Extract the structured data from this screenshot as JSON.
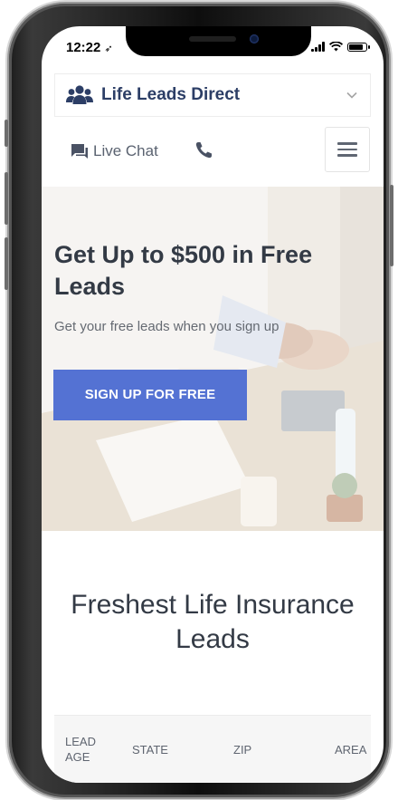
{
  "status_bar": {
    "time": "12:22"
  },
  "brand": {
    "name": "Life Leads Direct",
    "color": "#2c3e66"
  },
  "nav": {
    "live_chat_label": "Live Chat"
  },
  "hero": {
    "title": "Get Up to $500 in Free Leads",
    "subtitle": "Get your free leads when you sign up",
    "cta_label": "SIGN UP FOR FREE",
    "cta_color": "#5472d3"
  },
  "section": {
    "title": "Freshest Life Insurance Leads"
  },
  "table": {
    "columns": [
      "LEAD AGE",
      "STATE",
      "ZIP",
      "AREA"
    ]
  },
  "icons": {
    "brand": "users-group-icon",
    "chat": "chat-bubble-icon",
    "phone": "phone-icon",
    "menu": "hamburger-menu-icon",
    "dropdown": "chevron-down-icon"
  }
}
